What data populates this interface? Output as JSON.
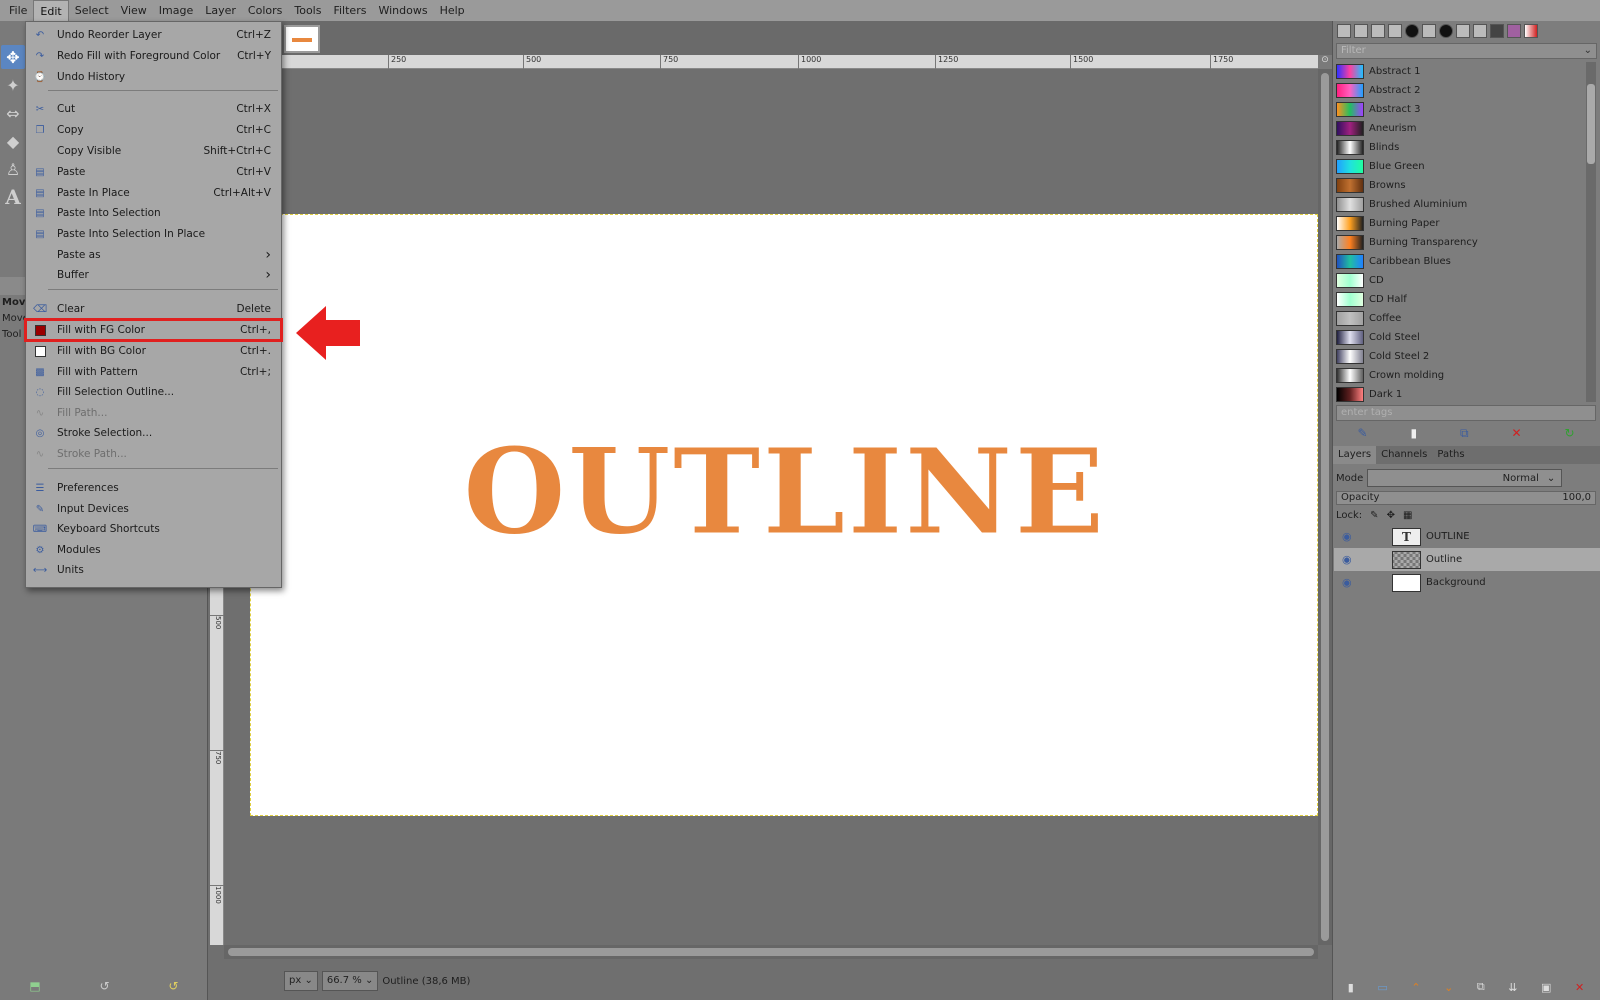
{
  "menubar": {
    "items": [
      "File",
      "Edit",
      "Select",
      "View",
      "Image",
      "Layer",
      "Colors",
      "Tools",
      "Filters",
      "Windows",
      "Help"
    ],
    "active": "Edit"
  },
  "toolbox": {
    "tool_options_rows": [
      "Move",
      "Move:",
      "Tool"
    ],
    "icons": [
      "move-tool-icon",
      "fuzzy-select-icon",
      "align-tool-icon",
      "eraser-icon",
      "clone-stamp-icon",
      "text-tool-icon"
    ]
  },
  "edit_menu": {
    "items": [
      {
        "label": "Undo Reorder Layer",
        "shortcut": "Ctrl+Z",
        "icon": "undo-icon",
        "disabled": false
      },
      {
        "label": "Redo Fill with Foreground Color",
        "shortcut": "Ctrl+Y",
        "icon": "redo-icon",
        "disabled": false
      },
      {
        "label": "Undo History",
        "shortcut": "",
        "icon": "undo-history-icon",
        "disabled": false
      },
      {
        "label": "Cut",
        "shortcut": "Ctrl+X",
        "icon": "scissors-icon",
        "disabled": false
      },
      {
        "label": "Copy",
        "shortcut": "Ctrl+C",
        "icon": "copy-icon",
        "disabled": false
      },
      {
        "label": "Copy Visible",
        "shortcut": "Shift+Ctrl+C",
        "icon": "",
        "disabled": false
      },
      {
        "label": "Paste",
        "shortcut": "Ctrl+V",
        "icon": "paste-icon",
        "disabled": false
      },
      {
        "label": "Paste In Place",
        "shortcut": "Ctrl+Alt+V",
        "icon": "paste-icon",
        "disabled": false
      },
      {
        "label": "Paste Into Selection",
        "shortcut": "",
        "icon": "paste-icon",
        "disabled": false
      },
      {
        "label": "Paste Into Selection In Place",
        "shortcut": "",
        "icon": "paste-icon",
        "disabled": false
      },
      {
        "label": "Paste as",
        "shortcut": "",
        "icon": "",
        "disabled": false,
        "submenu": true
      },
      {
        "label": "Buffer",
        "shortcut": "",
        "icon": "",
        "disabled": false,
        "submenu": true
      },
      {
        "label": "Clear",
        "shortcut": "Delete",
        "icon": "eraser-icon",
        "disabled": false
      },
      {
        "label": "Fill with FG Color",
        "shortcut": "Ctrl+,",
        "icon": "fg-swatch-icon",
        "disabled": false,
        "highlighted": true
      },
      {
        "label": "Fill with BG Color",
        "shortcut": "Ctrl+.",
        "icon": "bg-swatch-icon",
        "disabled": false
      },
      {
        "label": "Fill with Pattern",
        "shortcut": "Ctrl+;",
        "icon": "pattern-icon",
        "disabled": false
      },
      {
        "label": "Fill Selection Outline...",
        "shortcut": "",
        "icon": "selection-outline-icon",
        "disabled": false
      },
      {
        "label": "Fill Path...",
        "shortcut": "",
        "icon": "path-icon",
        "disabled": true
      },
      {
        "label": "Stroke Selection...",
        "shortcut": "",
        "icon": "stroke-selection-icon",
        "disabled": false
      },
      {
        "label": "Stroke Path...",
        "shortcut": "",
        "icon": "stroke-path-icon",
        "disabled": true
      },
      {
        "label": "Preferences",
        "shortcut": "",
        "icon": "preferences-icon",
        "disabled": false
      },
      {
        "label": "Input Devices",
        "shortcut": "",
        "icon": "input-devices-icon",
        "disabled": false
      },
      {
        "label": "Keyboard Shortcuts",
        "shortcut": "",
        "icon": "keyboard-icon",
        "disabled": false
      },
      {
        "label": "Modules",
        "shortcut": "",
        "icon": "modules-icon",
        "disabled": false
      },
      {
        "label": "Units",
        "shortcut": "",
        "icon": "units-icon",
        "disabled": false
      }
    ]
  },
  "canvas": {
    "text": "OUTLINE",
    "text_color": "#e8883f",
    "ruler_h_ticks": [
      "250",
      "500",
      "750",
      "1000",
      "1250",
      "1500",
      "1750"
    ],
    "ruler_v_ticks": [
      "500",
      "750",
      "1000"
    ]
  },
  "statusbar": {
    "unit": "px",
    "zoom": "66.7 %",
    "info": "Outline (38,6 MB)"
  },
  "gradients": {
    "filter_placeholder": "Filter",
    "tags_placeholder": "enter tags",
    "items": [
      {
        "name": "Abstract 1",
        "colors": [
          "#3030ff",
          "#ff40a0",
          "#20c0ff"
        ]
      },
      {
        "name": "Abstract 2",
        "colors": [
          "#ff2080",
          "#ff60c0",
          "#20a0ff"
        ]
      },
      {
        "name": "Abstract 3",
        "colors": [
          "#ff9020",
          "#20c060",
          "#a040ff"
        ]
      },
      {
        "name": "Aneurism",
        "colors": [
          "#301060",
          "#a02080",
          "#202020"
        ]
      },
      {
        "name": "Blinds",
        "colors": [
          "#222222",
          "#ffffff",
          "#222222"
        ]
      },
      {
        "name": "Blue Green",
        "colors": [
          "#20a0ff",
          "#20e0e0",
          "#20ffa0"
        ]
      },
      {
        "name": "Browns",
        "colors": [
          "#804010",
          "#c07030",
          "#603010"
        ]
      },
      {
        "name": "Brushed Aluminium",
        "colors": [
          "#909090",
          "#e0e0e0",
          "#a0a0a0"
        ]
      },
      {
        "name": "Burning Paper",
        "colors": [
          "#ffffff",
          "#ffa020",
          "#202020"
        ]
      },
      {
        "name": "Burning Transparency",
        "colors": [
          "#aaaaaa",
          "#ff8020",
          "#202020"
        ]
      },
      {
        "name": "Caribbean Blues",
        "colors": [
          "#2050c0",
          "#20c0a0",
          "#2080ff"
        ]
      },
      {
        "name": "CD",
        "colors": [
          "#e0ffe0",
          "#a0ffd0",
          "#ffffff"
        ]
      },
      {
        "name": "CD Half",
        "colors": [
          "#ffffff",
          "#a0ffd0",
          "#e0ffe0"
        ]
      },
      {
        "name": "Coffee",
        "colors": [
          "#a0a0a0",
          "#c0c0c0",
          "#a0a0a0"
        ]
      },
      {
        "name": "Cold Steel",
        "colors": [
          "#202040",
          "#e0e0f0",
          "#606080"
        ]
      },
      {
        "name": "Cold Steel 2",
        "colors": [
          "#404060",
          "#ffffff",
          "#808090"
        ]
      },
      {
        "name": "Crown molding",
        "colors": [
          "#303030",
          "#ffffff",
          "#606060"
        ]
      },
      {
        "name": "Dark 1",
        "colors": [
          "#000000",
          "#602020",
          "#ff8080"
        ]
      }
    ]
  },
  "layers_panel": {
    "tabs": [
      "Layers",
      "Channels",
      "Paths"
    ],
    "mode_label": "Mode",
    "mode_value": "Normal",
    "opacity_label": "Opacity",
    "opacity_value": "100,0",
    "lock_label": "Lock:",
    "layers": [
      {
        "name": "OUTLINE",
        "type": "text",
        "active": false
      },
      {
        "name": "Outline",
        "type": "transparent",
        "active": true
      },
      {
        "name": "Background",
        "type": "white",
        "active": false
      }
    ]
  }
}
